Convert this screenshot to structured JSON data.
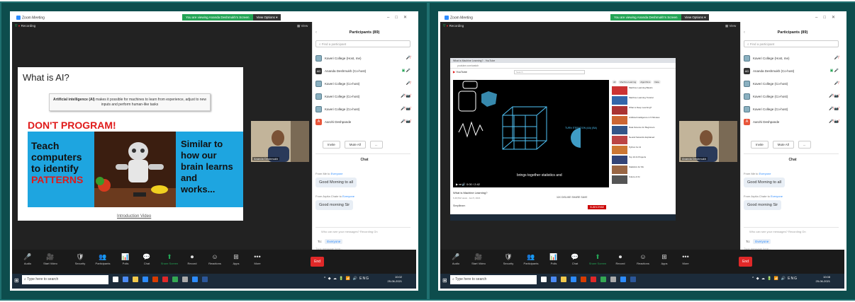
{
  "left": {
    "window_title": "Zoom Meeting",
    "share_status": "You are viewing Ananda Deshmukh's Screen",
    "view_options": "View Options",
    "recording": "Recording",
    "view_label": "View",
    "slide": {
      "title": "What is AI?",
      "definition_bold": "Artificial intelligence (AI)",
      "definition_rest": " makes it possible for machines to learn from experience, adjust to new inputs and perform human-like tasks",
      "headline": "DON'T PROGRAM!",
      "left_text": [
        "Teach",
        "computers",
        "to identify"
      ],
      "left_highlight": "PATTERNS",
      "right_text": [
        "Similar to",
        "how our",
        "brain learns",
        "and",
        "works..."
      ],
      "link": "Introduction Video"
    },
    "camera_name": "Ananda Deshmukh",
    "panel": {
      "hide": "‹",
      "title": "Participants (89)",
      "search_placeholder": "Find a participant",
      "participants": [
        {
          "name": "Kaveri College (Host, me)",
          "avatar": "college"
        },
        {
          "name": "Ananda Deshmukh (Co-host)",
          "avatar": "AD"
        },
        {
          "name": "Kaveri College (Co-host)",
          "avatar": "college"
        },
        {
          "name": "Kaveri College (Co-host)",
          "avatar": "college"
        },
        {
          "name": "Kaveri College (Co-host)",
          "avatar": "college"
        },
        {
          "name": "Aarohi Deshpande",
          "avatar": "A"
        }
      ],
      "invite": "Invite",
      "mute_all": "Mute All",
      "more": "...",
      "chat_title": "Chat",
      "msg1_from": "From Me to ",
      "msg1_to": "Everyone",
      "msg1": "Good Morning to all",
      "msg2_from": "From Arpita Chate to ",
      "msg2_to": "Everyone",
      "msg2": "Good morning Sir",
      "who_can_see": "Who can see your messages? Recording On",
      "to_label": "To:",
      "to_value": "Everyone",
      "type_message": "Type message here..."
    },
    "toolbar": [
      {
        "label": "Audio",
        "icon": "🎤"
      },
      {
        "label": "Start Video",
        "icon": "🎥"
      },
      {
        "label": "Security",
        "icon": "🛡"
      },
      {
        "label": "Participants",
        "icon": "👥"
      },
      {
        "label": "Polls",
        "icon": "📊"
      },
      {
        "label": "Chat",
        "icon": "💬"
      },
      {
        "label": "Share Screen",
        "icon": "⬆"
      },
      {
        "label": "Record",
        "icon": "⏺"
      },
      {
        "label": "Reactions",
        "icon": "☺"
      },
      {
        "label": "Apps",
        "icon": "⊞"
      },
      {
        "label": "More",
        "icon": "•••"
      }
    ],
    "end_button": "End",
    "taskbar": {
      "search": "Type here to search",
      "time": "10:02",
      "date": "25-06-2021",
      "lang": "ENG"
    }
  },
  "right": {
    "window_title": "Zoom Meeting",
    "share_status": "You are viewing Ananda Deshmukh's Screen",
    "view_options": "View Options",
    "recording": "Recording",
    "view_label": "View",
    "browser": {
      "tab": "What is Machine Learning? - YouTube",
      "url": "youtube.com/watch",
      "youtube": "YouTube",
      "search": "Search",
      "caption": "brings together statistics and",
      "overlay_text": "TURN ITERATION (AA) (BA)",
      "time": "0:00 / 2:42",
      "video_title": "What is Machine Learning?",
      "video_meta": "6,49,532 views · Jan 5, 2021",
      "actions": "11K  DISLIKE  SHARE  SAVE",
      "channel": "Simplilearn",
      "subscribe": "SUBSCRIBE",
      "chips": [
        "All",
        "Machine learning",
        "Algorithms",
        "Data"
      ],
      "recs": [
        "Machine Learning Basics",
        "Machine Learning Tutorial",
        "What is Deep Learning?",
        "Artificial Intelligence in 5 Minutes",
        "Data Science for Beginners",
        "Neural Networks Explained",
        "Python for AI",
        "Top 10 AI Projects",
        "Statistics for ML",
        "Future of AI"
      ]
    },
    "camera_name": "Ananda Deshmukh",
    "panel": {
      "hide": "‹",
      "title": "Participants (89)",
      "search_placeholder": "Find a participant",
      "participants": [
        {
          "name": "Kaveri College (Host, me)",
          "avatar": "college"
        },
        {
          "name": "Ananda Deshmukh (Co-host)",
          "avatar": "AD"
        },
        {
          "name": "Kaveri College (Co-host)",
          "avatar": "college"
        },
        {
          "name": "Kaveri College (Co-host)",
          "avatar": "college"
        },
        {
          "name": "Kaveri College (Co-host)",
          "avatar": "college"
        },
        {
          "name": "Aarohi Deshpande",
          "avatar": "A"
        }
      ],
      "invite": "Invite",
      "mute_all": "Mute All",
      "more": "...",
      "chat_title": "Chat",
      "msg1_from": "From Me to ",
      "msg1_to": "Everyone",
      "msg1": "Good Morning to all",
      "msg2_from": "From Arpita Chate to ",
      "msg2_to": "Everyone",
      "msg2": "Good morning Sir",
      "who_can_see": "Who can see your messages? Recording On",
      "to_label": "To:",
      "to_value": "Everyone",
      "type_message": "Type message here..."
    },
    "toolbar": [
      {
        "label": "Audio",
        "icon": "🎤"
      },
      {
        "label": "Start Video",
        "icon": "🎥"
      },
      {
        "label": "Security",
        "icon": "🛡"
      },
      {
        "label": "Participants",
        "icon": "👥"
      },
      {
        "label": "Polls",
        "icon": "📊"
      },
      {
        "label": "Chat",
        "icon": "💬"
      },
      {
        "label": "Share Screen",
        "icon": "⬆"
      },
      {
        "label": "Record",
        "icon": "⏺"
      },
      {
        "label": "Reactions",
        "icon": "☺"
      },
      {
        "label": "Apps",
        "icon": "⊞"
      },
      {
        "label": "More",
        "icon": "•••"
      }
    ],
    "end_button": "End",
    "taskbar": {
      "search": "Type here to search",
      "time": "10:08",
      "date": "25-06-2021",
      "lang": "ENG"
    }
  },
  "colors": {
    "frame": "#0d4d4d",
    "zoom_blue": "#2d8cff",
    "share_green": "#23a455",
    "end_red": "#e02828",
    "slide_blue": "#1ea5e0",
    "patterns_red": "#e01a1a"
  }
}
